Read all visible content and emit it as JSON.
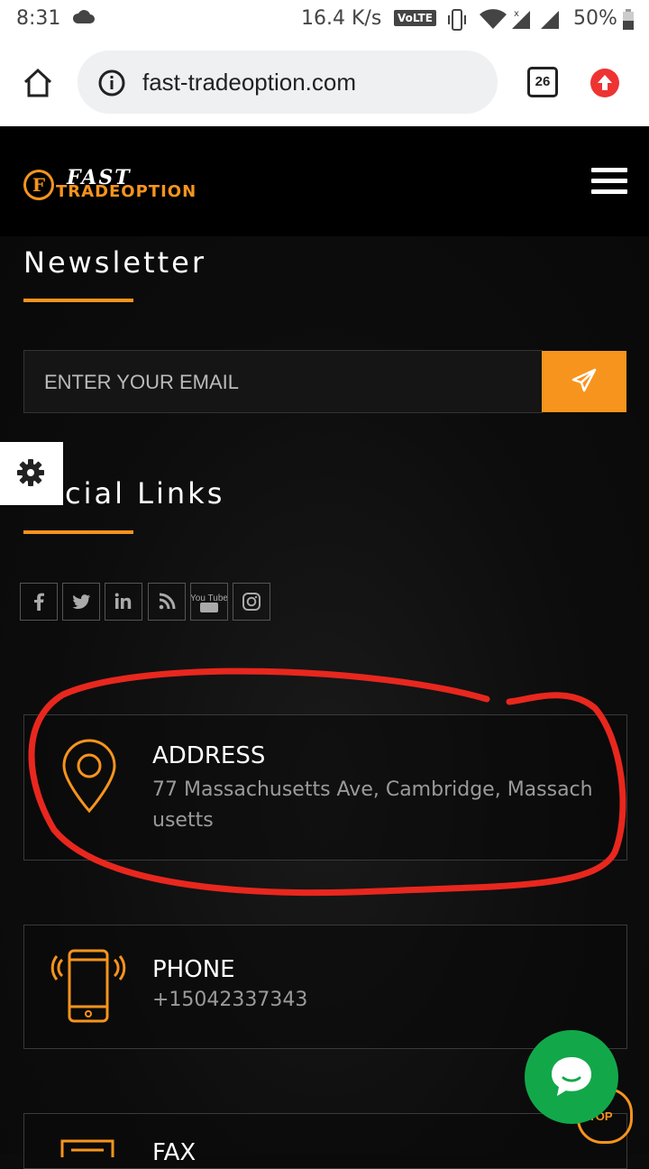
{
  "status_bar": {
    "time": "8:31",
    "network_speed": "16.4 K/s",
    "volte_badge": "VoLTE",
    "battery": "50%",
    "icons": [
      "cloud-icon",
      "vibrate-icon",
      "wifi-icon",
      "signal-icon",
      "battery-icon"
    ]
  },
  "browser": {
    "url": "fast-tradeoption.com",
    "tab_count": "26",
    "icons": [
      "home-icon",
      "info-icon",
      "update-icon"
    ]
  },
  "site": {
    "logo_word1": "FAST",
    "logo_word2": "TRADEOPTION",
    "logo_letter": "F",
    "accent_color": "#f7941d"
  },
  "newsletter": {
    "heading": "Newsletter",
    "email_placeholder": "ENTER YOUR EMAIL"
  },
  "social": {
    "heading": "cial Links",
    "links": [
      "facebook-icon",
      "twitter-icon",
      "linkedin-icon",
      "rss-icon",
      "youtube-icon",
      "instagram-icon"
    ],
    "youtube_label": "You Tube"
  },
  "contact": {
    "address_title": "ADDRESS",
    "address_line1": "77 Massachusetts Ave, Cambridge, Massach",
    "address_line2": "usetts",
    "phone_title": "PHONE",
    "phone_value": "+15042337343",
    "fax_title": "FAX"
  },
  "floating": {
    "top_label": "TOP"
  }
}
